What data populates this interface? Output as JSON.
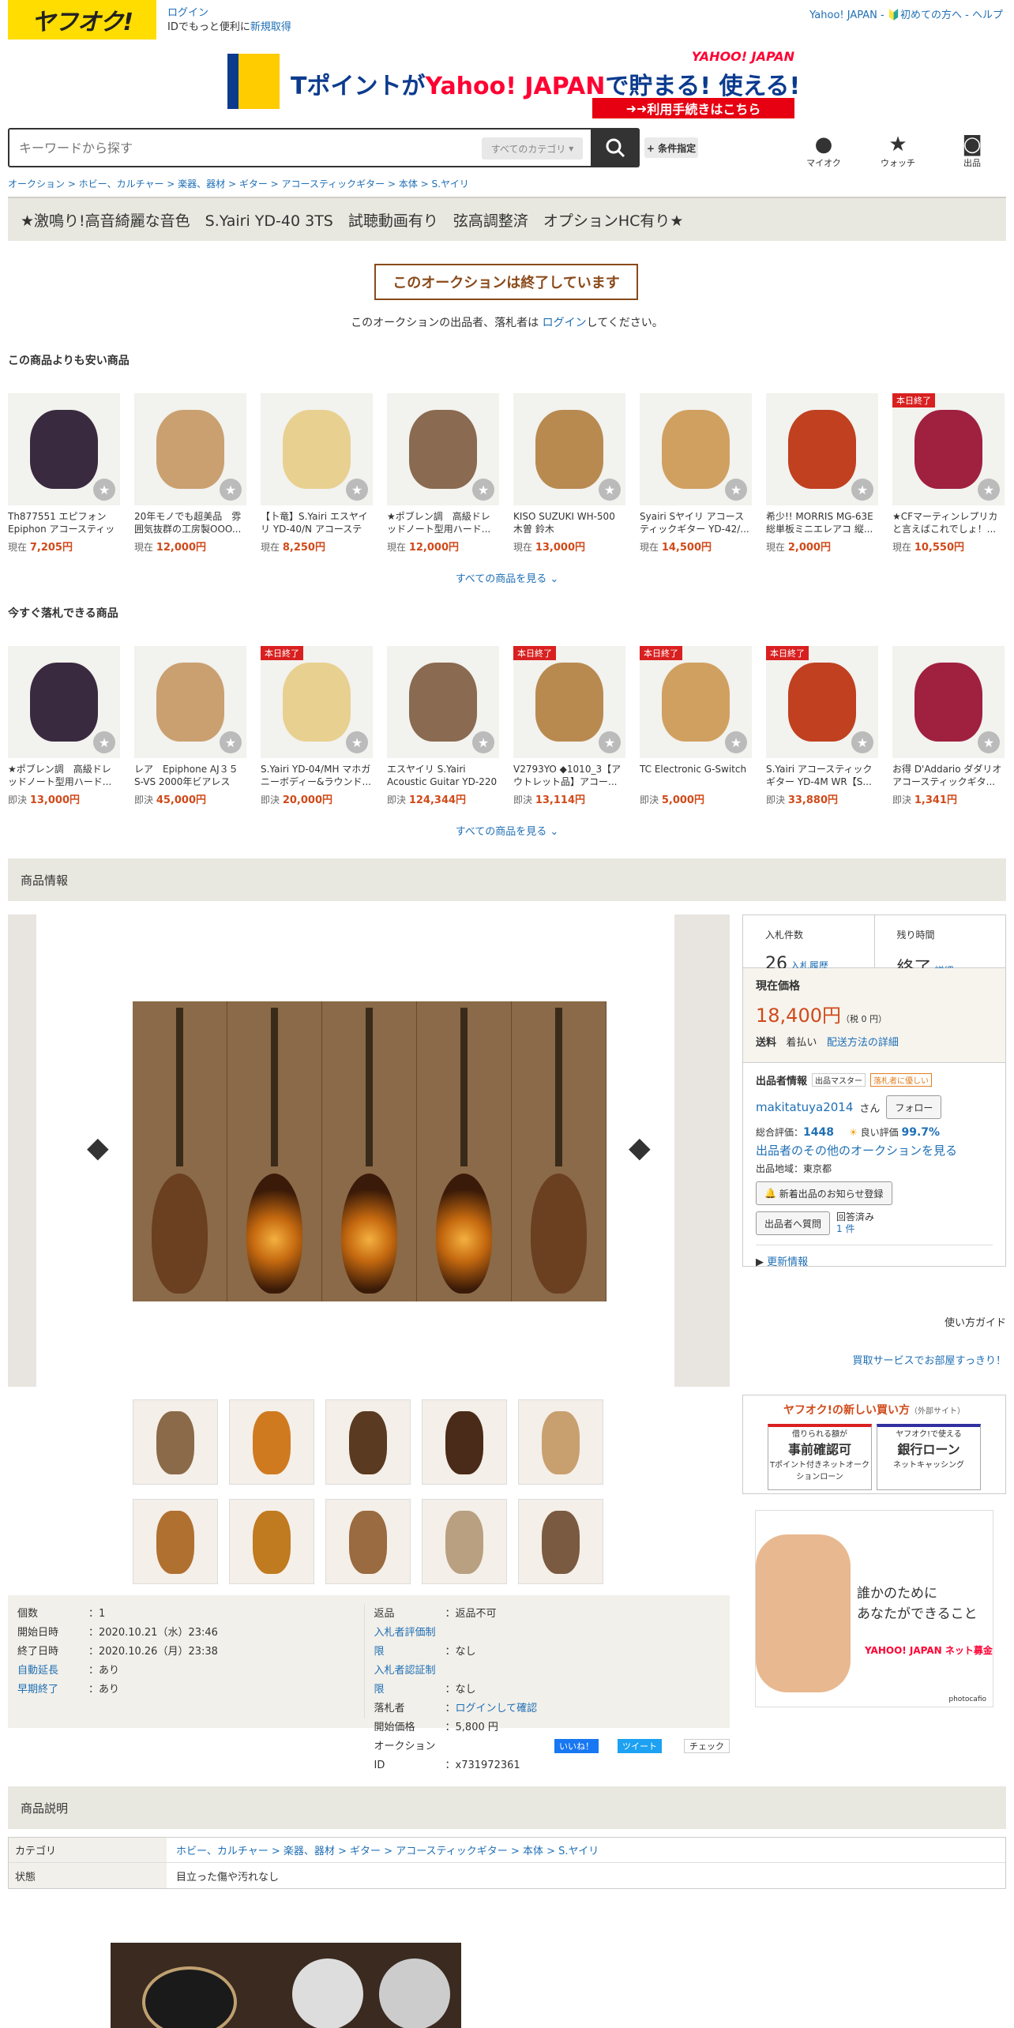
{
  "header": {
    "logo": "ヤフオク!",
    "login": "ログイン",
    "login_sub": "IDでもっと便利に",
    "new_id": "新規取得",
    "right_links": "Yahoo! JAPAN - 🔰初めての方へ - ヘルプ"
  },
  "banner": {
    "text_t": "Tポイントが",
    "text_y": "Yahoo! JAPAN",
    "text_tail": "で貯まる! 使える!",
    "badge": "YAHOO! JAPAN",
    "button": "利用手続きはこちら"
  },
  "search": {
    "placeholder": "キーワードから探す",
    "category": "すべてのカテゴリ",
    "conditions": "+ 条件指定"
  },
  "nav_icons": {
    "myauc": "マイオク",
    "watch": "ウォッチ",
    "sell": "出品"
  },
  "breadcrumb": "オークション > ホビー、カルチャー > 楽器、器材 > ギター > アコースティックギター > 本体 > S.ヤイリ",
  "title": "★激鳴り!高音綺麗な音色　S.Yairi YD-40 3TS　試聴動画有り　弦高調整済　オプションHC有り★",
  "ended": {
    "label": "このオークションは終了しています",
    "note_pre": "このオークションの出品者、落札者は",
    "note_link": "ログイン",
    "note_post": "してください。"
  },
  "cheaper": {
    "heading": "この商品よりも安い商品",
    "see_all": "すべての商品を見る",
    "items": [
      {
        "title": "Th877551 エピフォン Epiphon アコースティック...",
        "prefix": "現在",
        "price": "7,205円"
      },
      {
        "title": "20年モノでも超美品　雰囲気抜群の工房製OOO...",
        "prefix": "現在",
        "price": "12,000円"
      },
      {
        "title": "【卜竜】S.Yairi エスヤイリ YD-40/N アコースティ...",
        "prefix": "現在",
        "price": "8,250円"
      },
      {
        "title": "★ポブレン調　高級ドレッドノート型用ハード...",
        "prefix": "現在",
        "price": "12,000円"
      },
      {
        "title": "KISO SUZUKI WH-500 木曽 鈴木",
        "prefix": "現在",
        "price": "13,000円"
      },
      {
        "title": "Syairi Sヤイリ アコースティックギター YD-42/...",
        "prefix": "現在",
        "price": "14,500円"
      },
      {
        "title": "希少!! MORRIS MG-63E 総単板ミニエレアコ 縦...",
        "prefix": "現在",
        "price": "2,000円"
      },
      {
        "title": "★CFマーティンレプリカと言えばこれでしょ！...",
        "prefix": "現在",
        "price": "10,550円",
        "tag": "本日終了"
      }
    ]
  },
  "buynow": {
    "heading": "今すぐ落札できる商品",
    "see_all": "すべての商品を見る",
    "items": [
      {
        "title": "★ポブレン調　高級ドレッドノート型用ハード...",
        "prefix": "即決",
        "price": "13,000円"
      },
      {
        "title": "レア　Epiphone AJ３５S-VS 2000年ビアレス工...",
        "prefix": "即決",
        "price": "45,000円"
      },
      {
        "title": "S.Yairi YD-04/MH マホガニーボディー&ラウンド...",
        "prefix": "即決",
        "price": "20,000円",
        "tag": "本日終了"
      },
      {
        "title": "エスヤイリ S.Yairi Acoustic Guitar YD-220",
        "prefix": "即決",
        "price": "124,344円"
      },
      {
        "title": "V2793YO ◆1010_3【アウトレット品】アコー...",
        "prefix": "即決",
        "price": "13,114円",
        "tag": "本日終了"
      },
      {
        "title": "TC Electronic G-Switch",
        "prefix": "即決",
        "price": "5,000円",
        "tag": "本日終了"
      },
      {
        "title": "S.Yairi アコースティックギター YD-4M WR【S...",
        "prefix": "即決",
        "price": "33,880円",
        "tag": "本日終了"
      },
      {
        "title": "お得 D'Addario ダダリオ アコースティックギタ...",
        "prefix": "即決",
        "price": "1,341円"
      }
    ]
  },
  "product_info_heading": "商品情報",
  "bids": {
    "label": "入札件数",
    "count": "26",
    "history": "入札履歴",
    "time_label": "残り時間",
    "time": "終了",
    "detail": "詳細"
  },
  "price": {
    "label": "現在価格",
    "value": "18,400円",
    "tax": "（税 0 円）",
    "ship_label": "送料",
    "ship": "着払い",
    "ship_link": "配送方法の詳細"
  },
  "seller": {
    "heading": "出品者情報",
    "badge1": "出品マスター",
    "badge2": "落札者に優しい",
    "name": "makitatuya2014",
    "san": "さん",
    "follow": "フォロー",
    "rating_label": "総合評価：",
    "rating": "1448",
    "good_label": "良い評価",
    "good": "99.7%",
    "other": "出品者のその他のオークションを見る",
    "area": "出品地域：東京都",
    "notify": "新着出品のお知らせ登録",
    "question": "出品者へ質問",
    "answered": "回答済み",
    "answered_count": "1 件",
    "update": "更新情報"
  },
  "guide": "使い方ガイド",
  "kaitori": "買取サービスでお部屋すっきり！",
  "newway": {
    "title": "ヤフオク!の新しい買い方",
    "sub": "（外部サイト）",
    "b1_top": "借りられる額が",
    "b1_main": "事前確認可",
    "b1_sub": "Tポイント付きネットオークションローン",
    "b2_top": "ヤフオク!で使える",
    "b2_main": "銀行ローン",
    "b2_sub": "ネットキャッシング"
  },
  "ad": {
    "line1": "誰かのために",
    "line2": "あなたができること",
    "brand": "YAHOO! JAPAN ネット募金",
    "credit": "photocafio"
  },
  "details": {
    "left": [
      {
        "k": "個数",
        "v": "1"
      },
      {
        "k": "開始日時",
        "v": "2020.10.21（水）23:46"
      },
      {
        "k": "終了日時",
        "v": "2020.10.26（月）23:38"
      },
      {
        "k": "自動延長",
        "v": "あり",
        "link": true
      },
      {
        "k": "早期終了",
        "v": "あり",
        "link": true
      }
    ],
    "right": [
      {
        "k": "返品",
        "v": "返品不可"
      },
      {
        "k": "入札者評価制限",
        "v": "なし",
        "link": true
      },
      {
        "k": "入札者認証制限",
        "v": "なし",
        "link": true
      },
      {
        "k": "落札者",
        "v": "ログインして確認",
        "vlink": true
      },
      {
        "k": "開始価格",
        "v": "5,800 円"
      },
      {
        "k": "オークションID",
        "v": "x731972361"
      }
    ]
  },
  "share": {
    "like": "いいね！",
    "tweet": "ツイート",
    "check": "チェック"
  },
  "description": {
    "heading": "商品説明",
    "cat_k": "カテゴリ",
    "cat_v": "ホビー、カルチャー > 楽器、器材 > ギター > アコースティックギター > 本体 > S.ヤイリ",
    "cond_k": "状態",
    "cond_v": "目立った傷や汚れなし"
  },
  "colors": {
    "accent": "#ffdd00",
    "price": "#d04a1a",
    "link": "#1f6fb5"
  }
}
